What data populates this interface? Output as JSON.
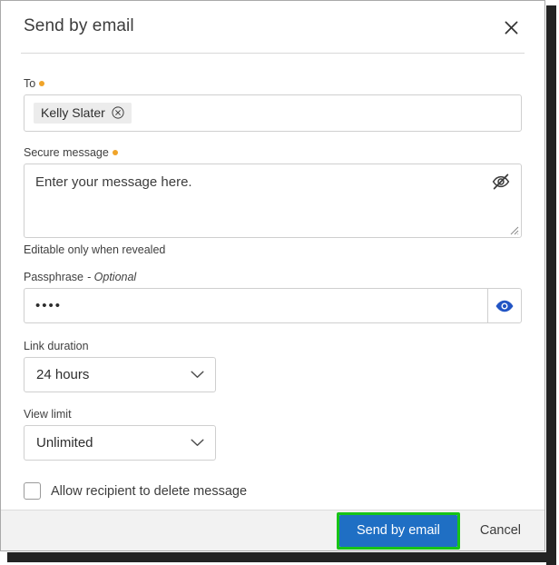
{
  "dialog": {
    "title": "Send by email",
    "close_icon": "close-icon"
  },
  "fields": {
    "to": {
      "label": "To",
      "required": true,
      "chips": [
        {
          "name": "Kelly Slater",
          "remove_icon": "circle-x-icon"
        }
      ]
    },
    "secure_message": {
      "label": "Secure message",
      "required": true,
      "placeholder": "Enter your message here.",
      "value": "",
      "reveal_icon": "eye-off-icon",
      "helper_text": "Editable only when revealed"
    },
    "passphrase": {
      "label": "Passphrase",
      "optional_tag": "- Optional",
      "value": "••••",
      "reveal_icon": "eye-icon"
    },
    "link_duration": {
      "label": "Link duration",
      "value": "24 hours",
      "chevron_icon": "chevron-down-icon"
    },
    "view_limit": {
      "label": "View limit",
      "value": "Unlimited",
      "chevron_icon": "chevron-down-icon"
    },
    "allow_delete": {
      "label": "Allow recipient to delete message",
      "checked": false
    }
  },
  "footer": {
    "submit_label": "Send by email",
    "cancel_label": "Cancel"
  },
  "colors": {
    "primary_button": "#1f6fc4",
    "highlight_ring": "#17c417",
    "required_marker": "#f0a429",
    "reveal_icon": "#1f4fbf",
    "footer_background": "#f2f2f2"
  }
}
